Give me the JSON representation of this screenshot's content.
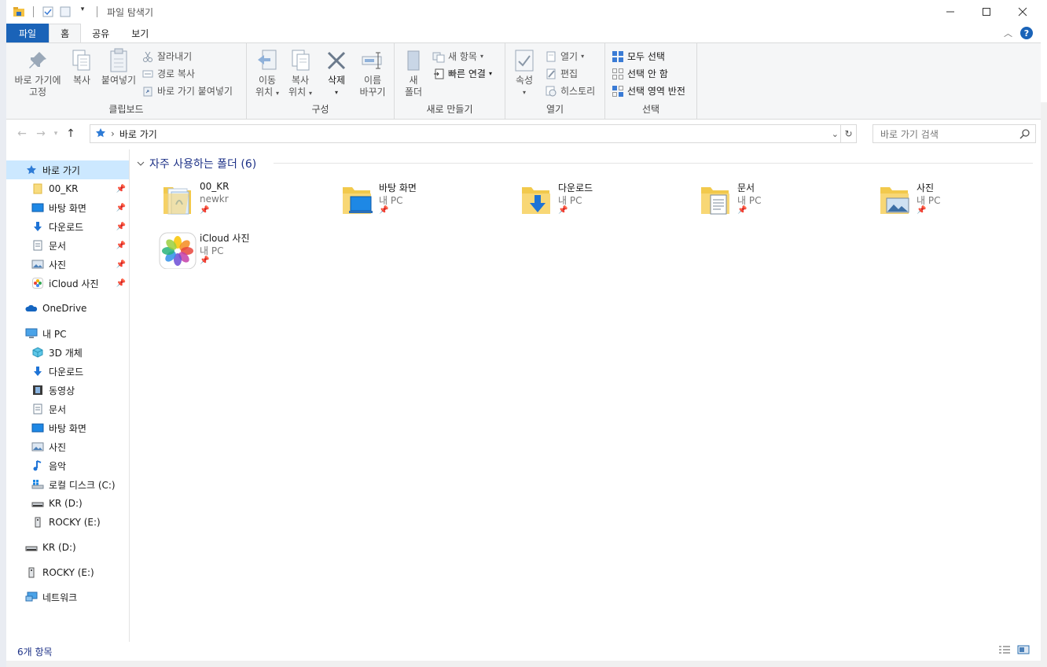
{
  "window": {
    "title": "파일 탐색기"
  },
  "tabs": [
    "파일",
    "홈",
    "공유",
    "보기"
  ],
  "ribbon": {
    "clipboard": {
      "label": "클립보드",
      "pin_label_1": "바로 가기에",
      "pin_label_2": "고정",
      "copy": "복사",
      "paste": "붙여넣기",
      "cut": "잘라내기",
      "copy_path": "경로 복사",
      "paste_shortcut": "바로 가기 붙여넣기"
    },
    "organize": {
      "label": "구성",
      "move_1": "이동",
      "move_2": "위치",
      "copyto_1": "복사",
      "copyto_2": "위치",
      "delete": "삭제",
      "rename_1": "이름",
      "rename_2": "바꾸기"
    },
    "new": {
      "label": "새로 만들기",
      "folder_1": "새",
      "folder_2": "폴더",
      "new_item": "새 항목",
      "easy_access": "빠른 연결"
    },
    "open": {
      "label": "열기",
      "properties": "속성",
      "open": "열기",
      "edit": "편집",
      "history": "히스토리"
    },
    "select": {
      "label": "선택",
      "select_all": "모두 선택",
      "select_none": "선택 안 함",
      "invert": "선택 영역 반전"
    }
  },
  "address": {
    "path": "바로 가기",
    "separator": "›"
  },
  "search": {
    "placeholder": "바로 가기 검색"
  },
  "sidebar": {
    "quick_access": "바로 가기",
    "pinned": [
      "00_KR",
      "바탕 화면",
      "다운로드",
      "문서",
      "사진",
      "iCloud 사진"
    ],
    "onedrive": "OneDrive",
    "this_pc": "내 PC",
    "pc_items": [
      "3D 개체",
      "다운로드",
      "동영상",
      "문서",
      "바탕 화면",
      "사진",
      "음악",
      "로컬 디스크 (C:)",
      "KR (D:)",
      "ROCKY (E:)"
    ],
    "kr_drive": "KR (D:)",
    "rocky_drive": "ROCKY (E:)",
    "network": "네트워크"
  },
  "content": {
    "section_title": "자주 사용하는 폴더 (6)",
    "folders": [
      {
        "name": "00_KR",
        "location": "newkr"
      },
      {
        "name": "바탕 화면",
        "location": "내 PC"
      },
      {
        "name": "다운로드",
        "location": "내 PC"
      },
      {
        "name": "문서",
        "location": "내 PC"
      },
      {
        "name": "사진",
        "location": "내 PC"
      },
      {
        "name": "iCloud 사진",
        "location": "내 PC"
      }
    ]
  },
  "status": {
    "count": "6개 항목"
  },
  "colors": {
    "accent": "#1a63b8",
    "selection": "#cce8ff",
    "header_text": "#1e3287"
  }
}
